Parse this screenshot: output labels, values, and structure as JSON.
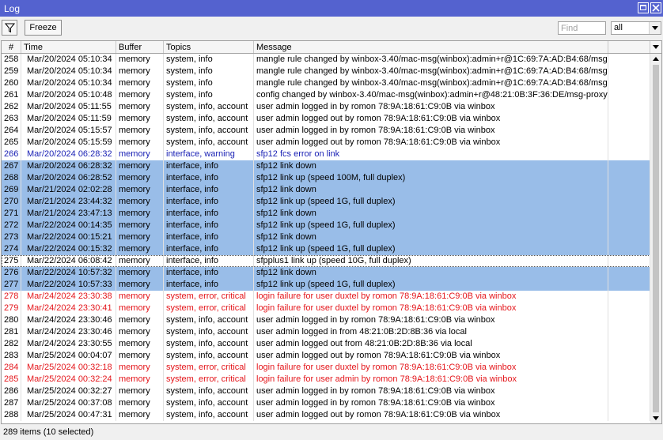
{
  "window": {
    "title": "Log"
  },
  "toolbar": {
    "freeze_label": "Freeze",
    "find_placeholder": "Find",
    "topic_select_value": "all"
  },
  "columns": {
    "num": "#",
    "time": "Time",
    "buffer": "Buffer",
    "topics": "Topics",
    "message": "Message"
  },
  "colors": {
    "titlebar": "#5462cf",
    "selected_row": "#99bde8",
    "warning_text": "#1b22b5",
    "critical_text": "#e4161b"
  },
  "rows": [
    {
      "num": "258",
      "time": "Mar/20/2024 05:10:34",
      "buffer": "memory",
      "topics": "system, info",
      "message": "mangle rule changed by winbox-3.40/mac-msg(winbox):admin+r@1C:69:7A:AD:B4:68/msg-...",
      "state": "normal"
    },
    {
      "num": "259",
      "time": "Mar/20/2024 05:10:34",
      "buffer": "memory",
      "topics": "system, info",
      "message": "mangle rule changed by winbox-3.40/mac-msg(winbox):admin+r@1C:69:7A:AD:B4:68/msg-...",
      "state": "normal"
    },
    {
      "num": "260",
      "time": "Mar/20/2024 05:10:34",
      "buffer": "memory",
      "topics": "system, info",
      "message": "mangle rule changed by winbox-3.40/mac-msg(winbox):admin+r@1C:69:7A:AD:B4:68/msg-...",
      "state": "normal"
    },
    {
      "num": "261",
      "time": "Mar/20/2024 05:10:48",
      "buffer": "memory",
      "topics": "system, info",
      "message": "config changed by winbox-3.40/mac-msg(winbox):admin+r@48:21:0B:3F:36:DE/msg-proxy-...",
      "state": "normal"
    },
    {
      "num": "262",
      "time": "Mar/20/2024 05:11:55",
      "buffer": "memory",
      "topics": "system, info, account",
      "message": "user admin logged in by romon 78:9A:18:61:C9:0B via winbox",
      "state": "normal"
    },
    {
      "num": "263",
      "time": "Mar/20/2024 05:11:59",
      "buffer": "memory",
      "topics": "system, info, account",
      "message": "user admin logged out by romon 78:9A:18:61:C9:0B via winbox",
      "state": "normal"
    },
    {
      "num": "264",
      "time": "Mar/20/2024 05:15:57",
      "buffer": "memory",
      "topics": "system, info, account",
      "message": "user admin logged in by romon 78:9A:18:61:C9:0B via winbox",
      "state": "normal"
    },
    {
      "num": "265",
      "time": "Mar/20/2024 05:15:59",
      "buffer": "memory",
      "topics": "system, info, account",
      "message": "user admin logged out by romon 78:9A:18:61:C9:0B via winbox",
      "state": "normal"
    },
    {
      "num": "266",
      "time": "Mar/20/2024 06:28:32",
      "buffer": "memory",
      "topics": "interface, warning",
      "message": "sfp12 fcs error on link",
      "state": "warning"
    },
    {
      "num": "267",
      "time": "Mar/20/2024 06:28:32",
      "buffer": "memory",
      "topics": "interface, info",
      "message": "sfp12 link down",
      "state": "selected"
    },
    {
      "num": "268",
      "time": "Mar/20/2024 06:28:52",
      "buffer": "memory",
      "topics": "interface, info",
      "message": "sfp12 link up (speed 100M, full duplex)",
      "state": "selected"
    },
    {
      "num": "269",
      "time": "Mar/21/2024 02:02:28",
      "buffer": "memory",
      "topics": "interface, info",
      "message": "sfp12 link down",
      "state": "selected"
    },
    {
      "num": "270",
      "time": "Mar/21/2024 23:44:32",
      "buffer": "memory",
      "topics": "interface, info",
      "message": "sfp12 link up (speed 1G, full duplex)",
      "state": "selected"
    },
    {
      "num": "271",
      "time": "Mar/21/2024 23:47:13",
      "buffer": "memory",
      "topics": "interface, info",
      "message": "sfp12 link down",
      "state": "selected"
    },
    {
      "num": "272",
      "time": "Mar/22/2024 00:14:35",
      "buffer": "memory",
      "topics": "interface, info",
      "message": "sfp12 link up (speed 1G, full duplex)",
      "state": "selected"
    },
    {
      "num": "273",
      "time": "Mar/22/2024 00:15:21",
      "buffer": "memory",
      "topics": "interface, info",
      "message": "sfp12 link down",
      "state": "selected"
    },
    {
      "num": "274",
      "time": "Mar/22/2024 00:15:32",
      "buffer": "memory",
      "topics": "interface, info",
      "message": "sfp12 link up (speed 1G, full duplex)",
      "state": "selected"
    },
    {
      "num": "275",
      "time": "Mar/22/2024 06:08:42",
      "buffer": "memory",
      "topics": "interface, info",
      "message": "sfpplus1 link up (speed 10G, full duplex)",
      "state": "focused"
    },
    {
      "num": "276",
      "time": "Mar/22/2024 10:57:32",
      "buffer": "memory",
      "topics": "interface, info",
      "message": "sfp12 link down",
      "state": "selected"
    },
    {
      "num": "277",
      "time": "Mar/22/2024 10:57:33",
      "buffer": "memory",
      "topics": "interface, info",
      "message": "sfp12 link up (speed 1G, full duplex)",
      "state": "selected"
    },
    {
      "num": "278",
      "time": "Mar/24/2024 23:30:38",
      "buffer": "memory",
      "topics": "system, error, critical",
      "message": "login failure for user duxtel by romon 78:9A:18:61:C9:0B via winbox",
      "state": "critical"
    },
    {
      "num": "279",
      "time": "Mar/24/2024 23:30:41",
      "buffer": "memory",
      "topics": "system, error, critical",
      "message": "login failure for user duxtel by romon 78:9A:18:61:C9:0B via winbox",
      "state": "critical"
    },
    {
      "num": "280",
      "time": "Mar/24/2024 23:30:46",
      "buffer": "memory",
      "topics": "system, info, account",
      "message": "user admin logged in by romon 78:9A:18:61:C9:0B via winbox",
      "state": "normal"
    },
    {
      "num": "281",
      "time": "Mar/24/2024 23:30:46",
      "buffer": "memory",
      "topics": "system, info, account",
      "message": "user admin logged in from 48:21:0B:2D:8B:36 via local",
      "state": "normal"
    },
    {
      "num": "282",
      "time": "Mar/24/2024 23:30:55",
      "buffer": "memory",
      "topics": "system, info, account",
      "message": "user admin logged out from 48:21:0B:2D:8B:36 via local",
      "state": "normal"
    },
    {
      "num": "283",
      "time": "Mar/25/2024 00:04:07",
      "buffer": "memory",
      "topics": "system, info, account",
      "message": "user admin logged out by romon 78:9A:18:61:C9:0B via winbox",
      "state": "normal"
    },
    {
      "num": "284",
      "time": "Mar/25/2024 00:32:18",
      "buffer": "memory",
      "topics": "system, error, critical",
      "message": "login failure for user duxtel by romon 78:9A:18:61:C9:0B via winbox",
      "state": "critical"
    },
    {
      "num": "285",
      "time": "Mar/25/2024 00:32:24",
      "buffer": "memory",
      "topics": "system, error, critical",
      "message": "login failure for user admin by romon 78:9A:18:61:C9:0B via winbox",
      "state": "critical"
    },
    {
      "num": "286",
      "time": "Mar/25/2024 00:32:27",
      "buffer": "memory",
      "topics": "system, info, account",
      "message": "user admin logged in by romon 78:9A:18:61:C9:0B via winbox",
      "state": "normal"
    },
    {
      "num": "287",
      "time": "Mar/25/2024 00:37:08",
      "buffer": "memory",
      "topics": "system, info, account",
      "message": "user admin logged in by romon 78:9A:18:61:C9:0B via winbox",
      "state": "normal"
    },
    {
      "num": "288",
      "time": "Mar/25/2024 00:47:31",
      "buffer": "memory",
      "topics": "system, info, account",
      "message": "user admin logged out by romon 78:9A:18:61:C9:0B via winbox",
      "state": "normal"
    }
  ],
  "status": {
    "text": "289 items (10 selected)"
  },
  "icons": {
    "filter": "filter-icon",
    "maximize": "maximize-icon",
    "close": "close-icon",
    "dropdown": "chevron-down-icon"
  }
}
